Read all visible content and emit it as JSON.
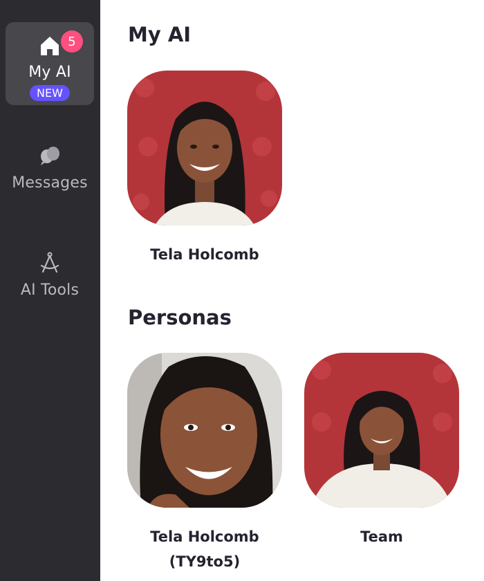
{
  "sidebar": {
    "items": [
      {
        "label": "My AI",
        "icon": "home-icon",
        "badge": "5",
        "tag": "NEW",
        "active": true
      },
      {
        "label": "Messages",
        "icon": "chat-bubbles-icon"
      },
      {
        "label": "AI Tools",
        "icon": "compass-drafting-icon"
      }
    ]
  },
  "sections": {
    "my_ai": {
      "title": "My AI",
      "cards": [
        {
          "name": "Tela Holcomb"
        }
      ]
    },
    "personas": {
      "title": "Personas",
      "cards": [
        {
          "name_line1": "Tela Holcomb",
          "name_line2": "(TY9to5)"
        },
        {
          "name": "Team"
        }
      ]
    }
  },
  "colors": {
    "sidebar_bg": "#2c2c30",
    "active_item_bg": "#47474c",
    "badge": "#ff4f7e",
    "new_tag": "#6552ff",
    "text_dark": "#24232f",
    "photo_background_red": "#b3353a"
  }
}
